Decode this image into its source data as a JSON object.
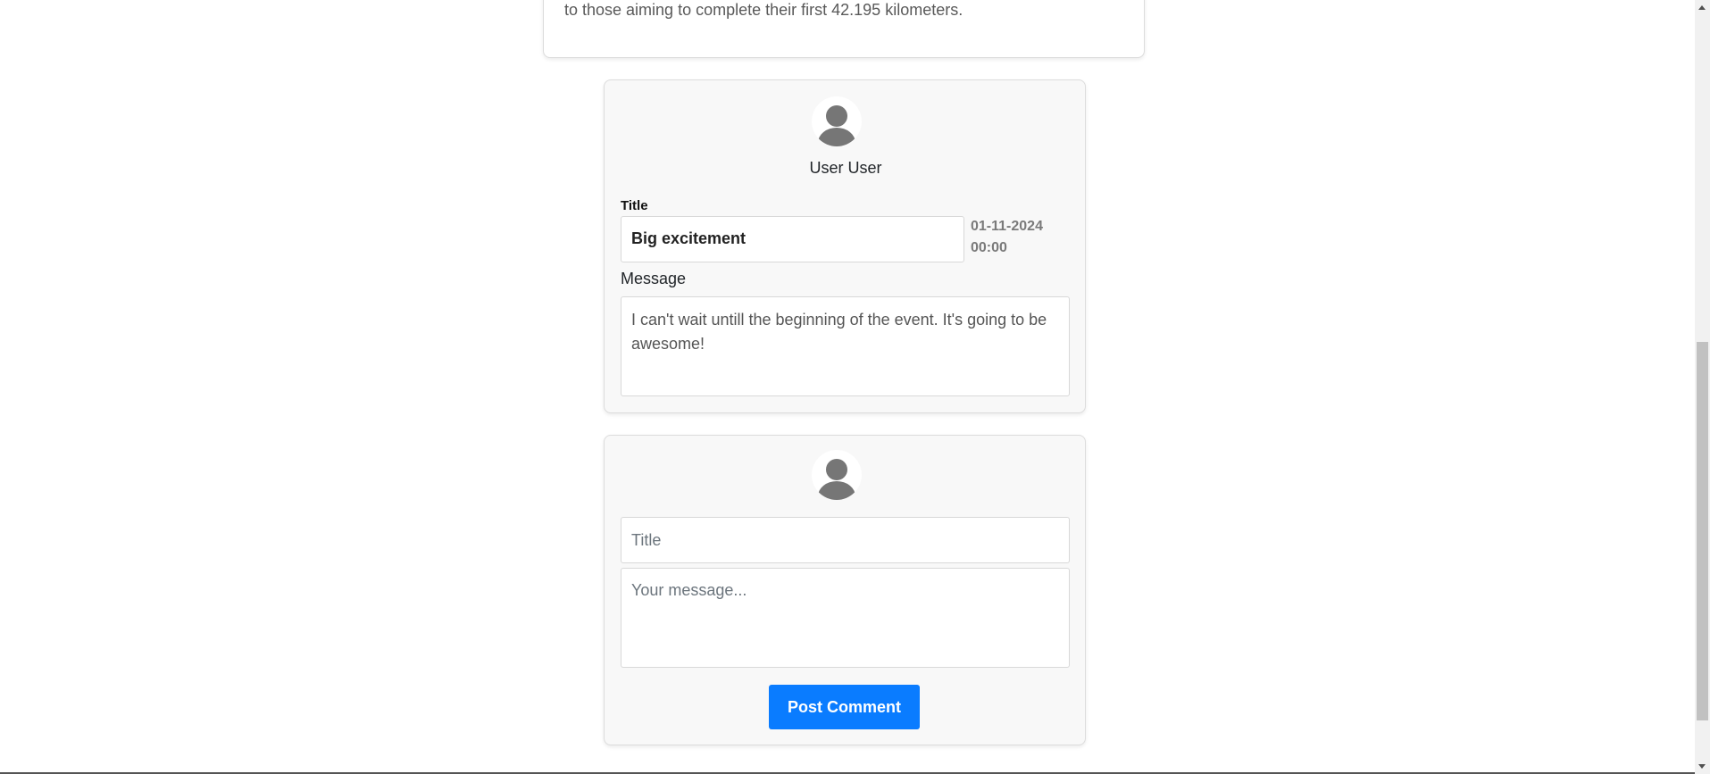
{
  "event": {
    "description_tail": "to those aiming to complete their first 42.195 kilometers."
  },
  "existing_comment": {
    "user_name": "User User",
    "title_label": "Title",
    "title_value": "Big excitement",
    "date": "01-11-2024",
    "time": "00:00",
    "message_label": "Message",
    "message_value": "I can't wait untill the beginning of the event. It's going to be awesome!"
  },
  "new_comment": {
    "title_placeholder": "Title",
    "message_placeholder": "Your message...",
    "post_label": "Post Comment"
  },
  "colors": {
    "accent": "#0a7cff",
    "card_background": "#f8f8f8",
    "avatar_silhouette": "#767676"
  }
}
